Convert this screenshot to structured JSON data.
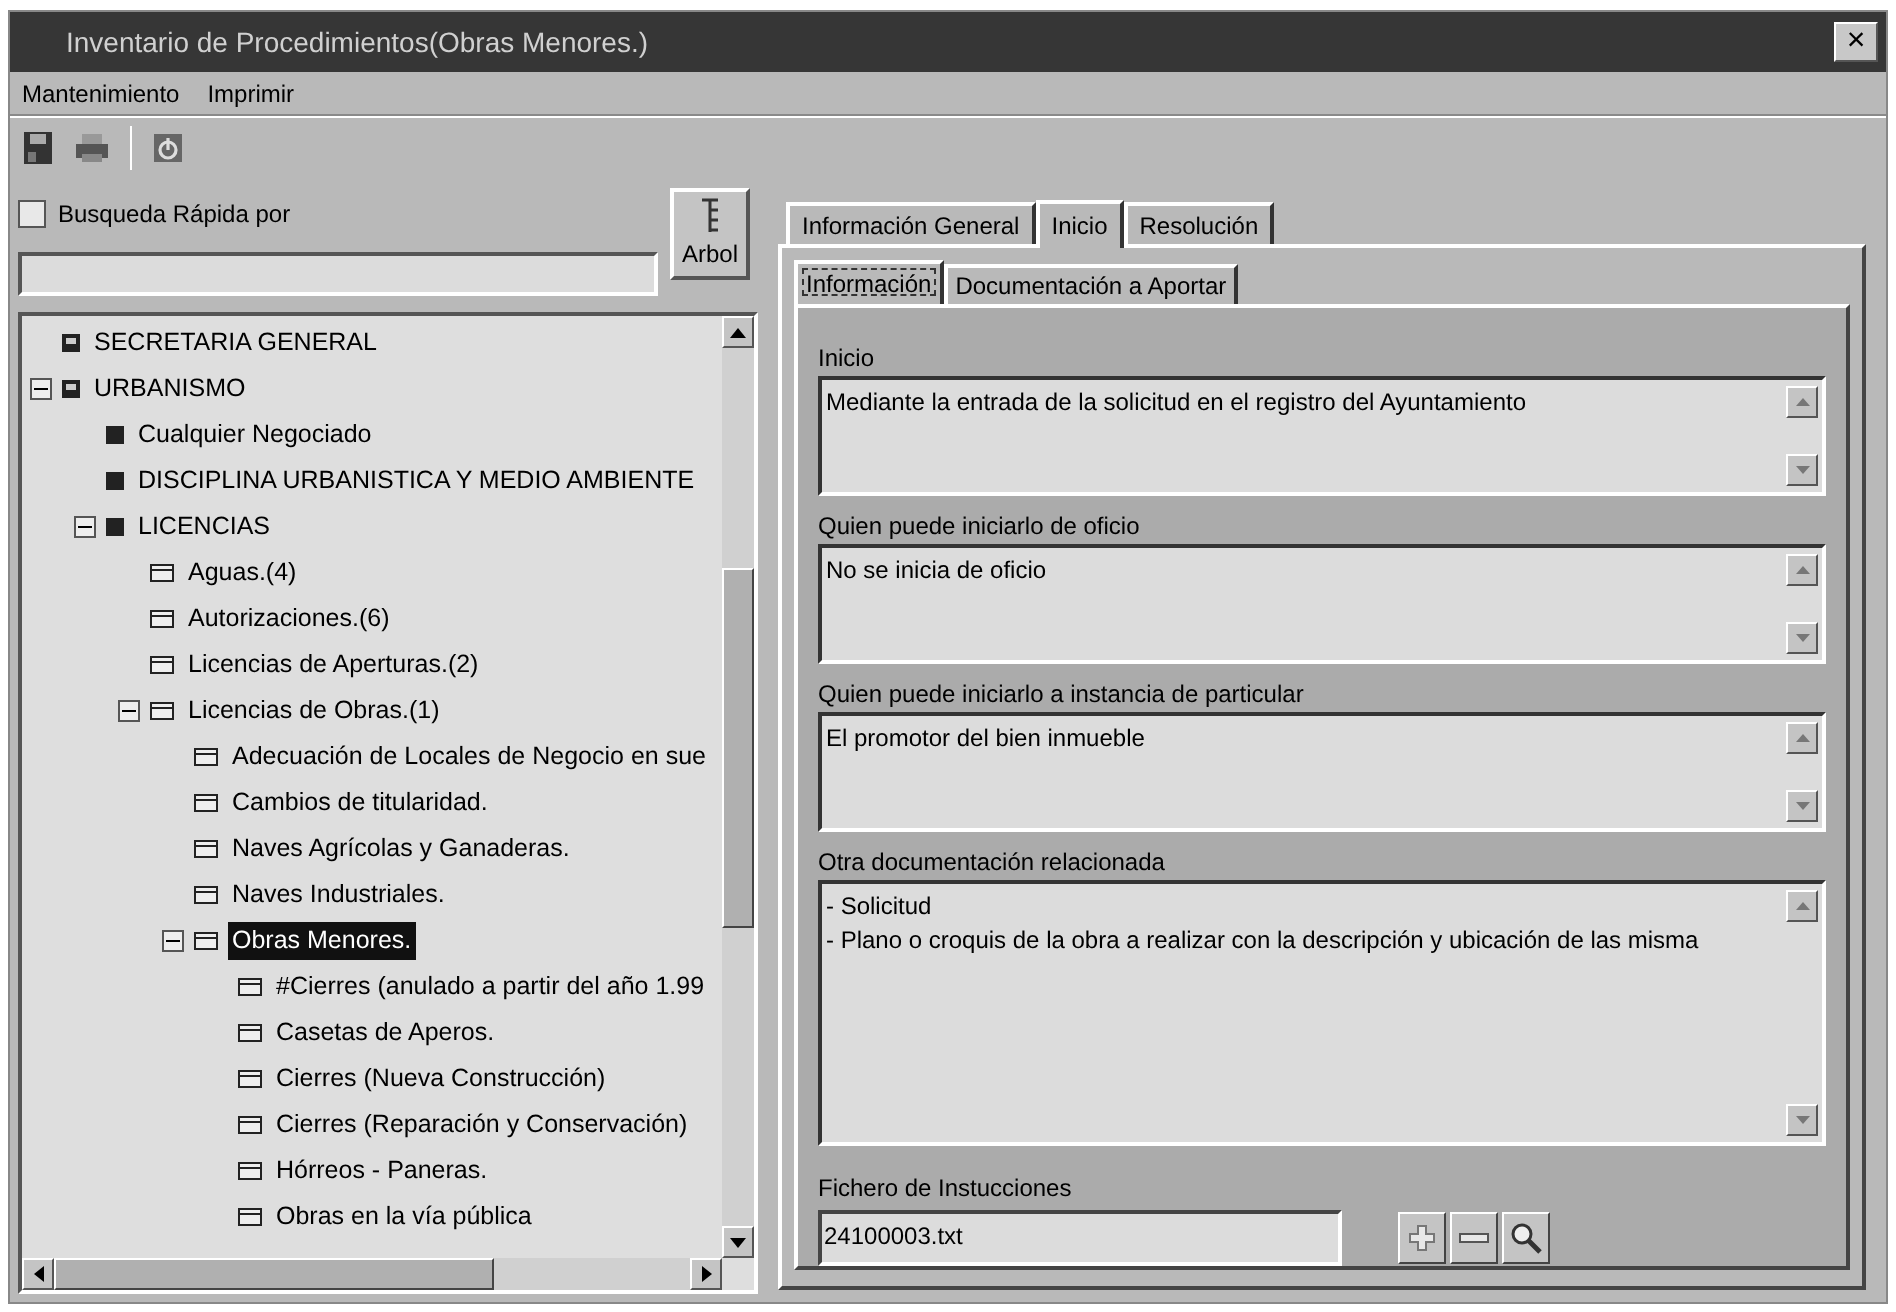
{
  "window": {
    "title": "Inventario de Procedimientos(Obras Menores.)",
    "close": "×"
  },
  "menu": [
    {
      "label": "Mantenimiento"
    },
    {
      "label": "Imprimir"
    }
  ],
  "quick_search": {
    "label": "Busqueda Rápida por",
    "checked": false
  },
  "tree_button": {
    "label": "Arbol"
  },
  "tree": [
    {
      "label": "SECRETARIA GENERAL",
      "selected": false,
      "expanded": false
    },
    {
      "label": "URBANISMO",
      "selected": false,
      "expanded": true,
      "children": [
        {
          "label": "Cualquier Negociado",
          "selected": false,
          "expanded": false
        },
        {
          "label": "DISCIPLINA URBANISTICA Y MEDIO AMBIENTE",
          "selected": false,
          "expanded": false
        },
        {
          "label": "LICENCIAS",
          "selected": false,
          "expanded": true,
          "children": [
            {
              "label": "Aguas.(4)",
              "selected": false,
              "expanded": false
            },
            {
              "label": "Autorizaciones.(6)",
              "selected": false,
              "expanded": false
            },
            {
              "label": "Licencias de Aperturas.(2)",
              "selected": false,
              "expanded": false
            },
            {
              "label": "Licencias de Obras.(1)",
              "selected": false,
              "expanded": true,
              "children": [
                {
                  "label": "Adecuación de Locales de Negocio en sue",
                  "selected": false,
                  "expanded": false
                },
                {
                  "label": "Cambios de titularidad.",
                  "selected": false,
                  "expanded": false
                },
                {
                  "label": "Naves Agrícolas y Ganaderas.",
                  "selected": false,
                  "expanded": false
                },
                {
                  "label": "Naves Industriales.",
                  "selected": false,
                  "expanded": false
                },
                {
                  "label": "Obras Menores.",
                  "selected": true,
                  "expanded": true,
                  "children": [
                    {
                      "label": "#Cierres (anulado a partir del año 1.99",
                      "selected": false,
                      "expanded": false
                    },
                    {
                      "label": "Casetas de Aperos.",
                      "selected": false,
                      "expanded": false
                    },
                    {
                      "label": "Cierres (Nueva Construcción)",
                      "selected": false,
                      "expanded": false
                    },
                    {
                      "label": "Cierres (Reparación y Conservación)",
                      "selected": false,
                      "expanded": false
                    },
                    {
                      "label": "Hórreos - Paneras.",
                      "selected": false,
                      "expanded": false
                    },
                    {
                      "label": "Obras en la vía pública",
                      "selected": false,
                      "expanded": false
                    }
                  ]
                }
              ]
            }
          ]
        }
      ]
    }
  ],
  "tabs": [
    {
      "label": "Información General",
      "selected": false
    },
    {
      "label": "Inicio",
      "selected": true
    },
    {
      "label": "Resolución",
      "selected": false
    }
  ],
  "subtabs": [
    {
      "label": "Información",
      "selected": true
    },
    {
      "label": "Documentación a Aportar",
      "selected": false
    }
  ],
  "fields": [
    {
      "label": "Inicio",
      "lines": [
        "Mediante la entrada de la solicitud en el registro del Ayuntamiento"
      ]
    },
    {
      "label": "Quien puede iniciarlo de oficio",
      "lines": [
        "No se inicia de oficio"
      ]
    },
    {
      "label": "Quien puede iniciarlo a instancia de particular",
      "lines": [
        "El promotor del bien inmueble"
      ]
    },
    {
      "label": "Otra documentación relacionada",
      "lines": [
        "- Solicitud",
        "- Plano o croquis de la obra a realizar con la descripción y ubicación de las misma"
      ]
    }
  ],
  "instructions_file": {
    "label": "Fichero de Instucciones",
    "value": "24100003.txt"
  }
}
